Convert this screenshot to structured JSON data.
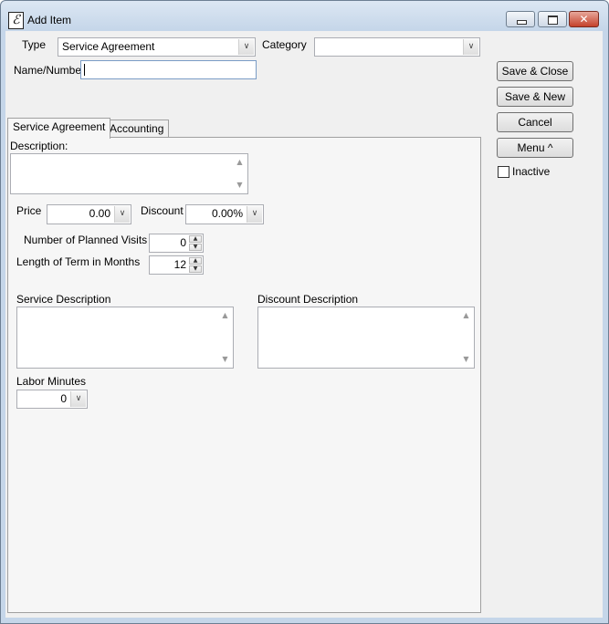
{
  "window": {
    "title": "Add Item"
  },
  "header": {
    "type_label": "Type",
    "type_value": "Service Agreement",
    "category_label": "Category",
    "category_value": "",
    "name_label": "Name/Number",
    "name_value": ""
  },
  "actions": {
    "save_close": "Save & Close",
    "save_new": "Save & New",
    "cancel": "Cancel",
    "menu": "Menu ^",
    "inactive_label": "Inactive",
    "inactive_checked": false
  },
  "tabs": [
    {
      "label": "Service Agreement",
      "active": true
    },
    {
      "label": "Accounting",
      "active": false
    }
  ],
  "form": {
    "description_label": "Description:",
    "description_value": "",
    "price_label": "Price",
    "price_value": "0.00",
    "discount_label": "Discount",
    "discount_value": "0.00%",
    "planned_visits_label": "Number of Planned Visits",
    "planned_visits_value": "0",
    "term_months_label": "Length of Term in Months",
    "term_months_value": "12",
    "service_description_label": "Service Description",
    "service_description_value": "",
    "discount_description_label": "Discount Description",
    "discount_description_value": "",
    "labor_minutes_label": "Labor Minutes",
    "labor_minutes_value": "0"
  },
  "icons": {
    "app": "e-logo-icon",
    "minimize": "minimize-icon",
    "maximize": "maximize-icon",
    "close": "close-icon",
    "dropdown": "chevron-down-icon",
    "scroll_up": "scroll-up-icon",
    "scroll_down": "scroll-down-icon",
    "spin_up": "spin-up-icon",
    "spin_down": "spin-down-icon"
  },
  "colors": {
    "close_button": "#c5412a",
    "chrome": "#c5d6e9",
    "panel": "#f0f0f0"
  }
}
